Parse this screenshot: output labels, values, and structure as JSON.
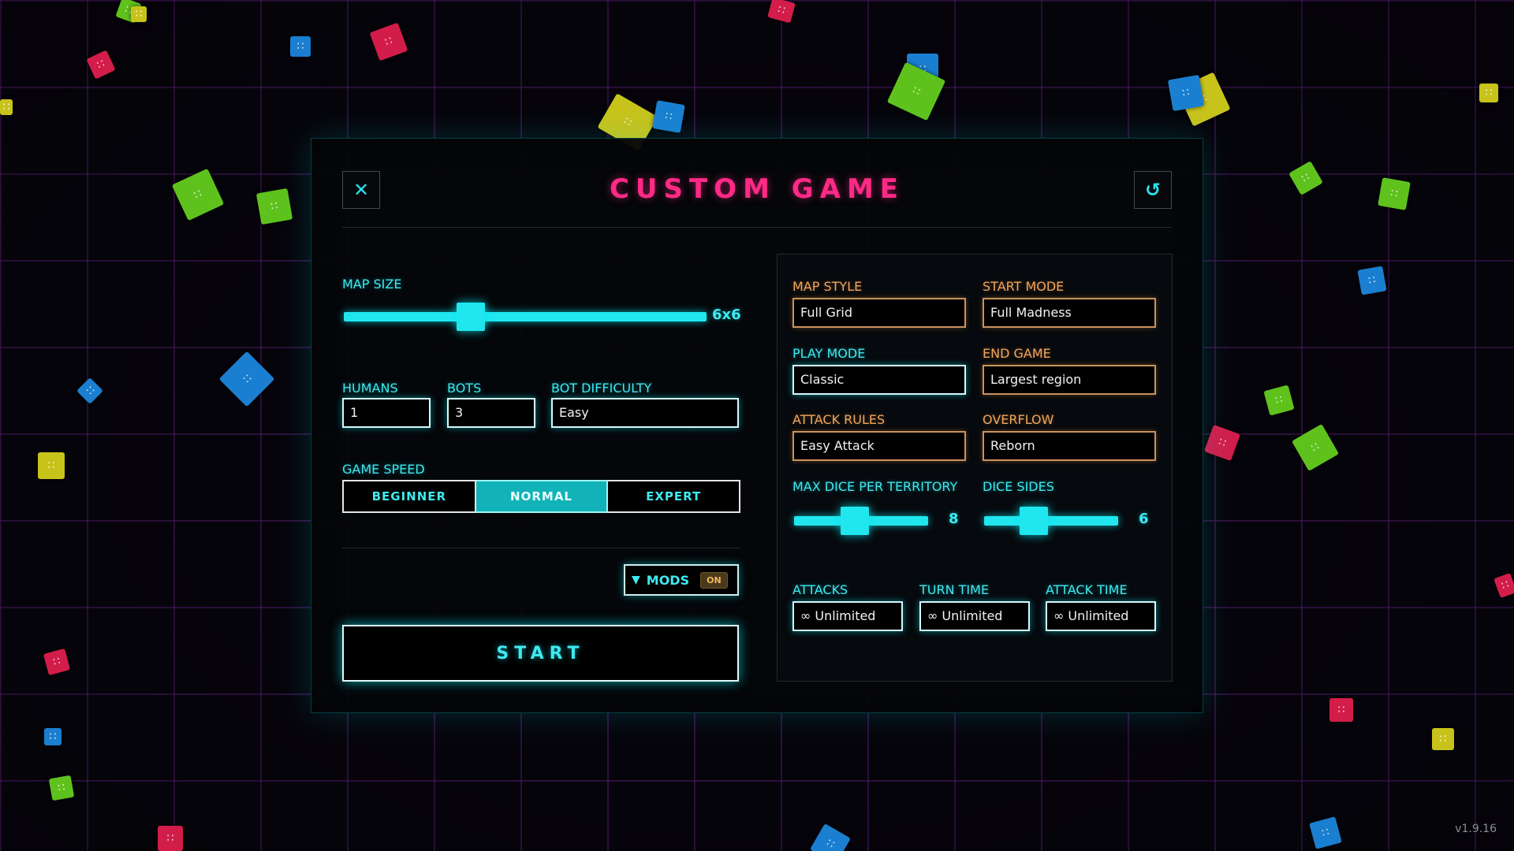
{
  "title": "CUSTOM GAME",
  "header": {
    "close_icon": "close-icon",
    "reset_icon": "reset-icon"
  },
  "map_size": {
    "label": "MAP SIZE",
    "value": "6x6",
    "fraction": 0.35
  },
  "players": {
    "humans_label": "HUMANS",
    "humans_value": "1",
    "bots_label": "BOTS",
    "bots_value": "3",
    "difficulty_label": "BOT DIFFICULTY",
    "difficulty_value": "Easy"
  },
  "game_speed": {
    "label": "GAME SPEED",
    "options": [
      "BEGINNER",
      "NORMAL",
      "EXPERT"
    ],
    "selected": "NORMAL"
  },
  "mods": {
    "label": "MODS",
    "state": "ON"
  },
  "start_label": "START",
  "settings": {
    "map_style_label": "MAP STYLE",
    "map_style_value": "Full Grid",
    "start_mode_label": "START MODE",
    "start_mode_value": "Full Madness",
    "play_mode_label": "PLAY MODE",
    "play_mode_value": "Classic",
    "end_game_label": "END GAME",
    "end_game_value": "Largest region",
    "attack_rules_label": "ATTACK RULES",
    "attack_rules_value": "Easy Attack",
    "overflow_label": "OVERFLOW",
    "overflow_value": "Reborn",
    "max_dice_label": "MAX DICE PER TERRITORY",
    "max_dice_value": "8",
    "max_dice_fraction": 0.45,
    "dice_sides_label": "DICE SIDES",
    "dice_sides_value": "6",
    "dice_sides_fraction": 0.37,
    "attacks_label": "ATTACKS",
    "attacks_value": "∞ Unlimited",
    "turn_time_label": "TURN TIME",
    "turn_time_value": "∞ Unlimited",
    "attack_time_label": "ATTACK TIME",
    "attack_time_value": "∞ Unlimited"
  },
  "version": "v1.9.16",
  "colors": {
    "accent": "#20e6ee",
    "title": "#ff2a86",
    "secondary": "#f2a55b"
  }
}
